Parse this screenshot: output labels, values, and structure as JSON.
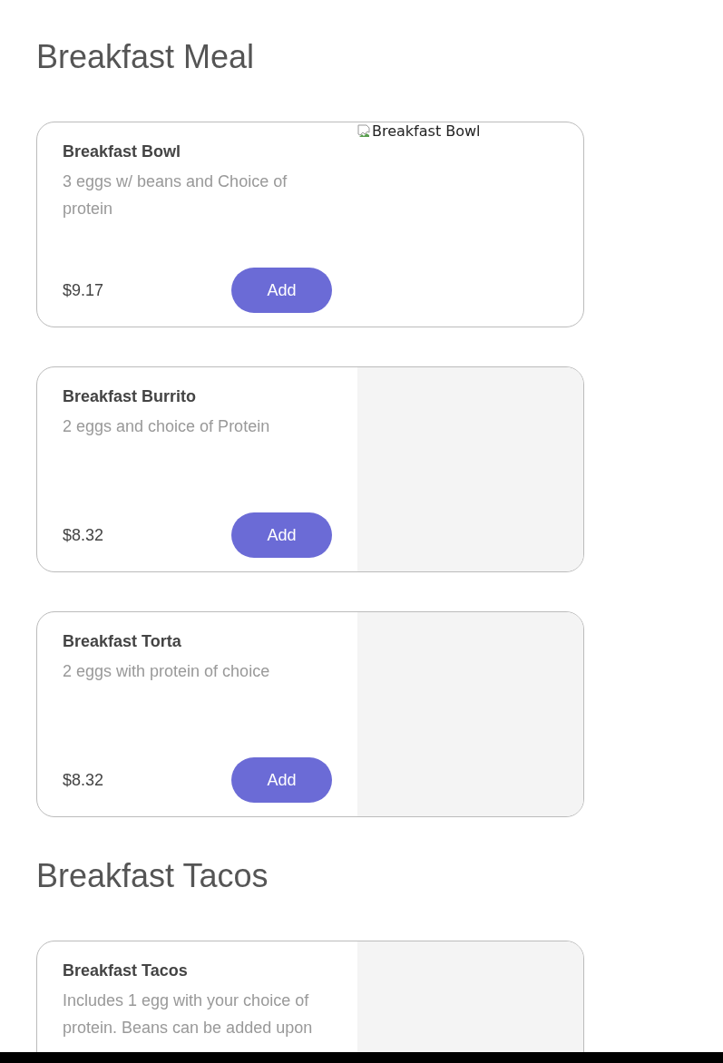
{
  "sections": [
    {
      "title": "Breakfast Meal",
      "items": [
        {
          "name": "Breakfast Bowl",
          "description": "3 eggs w/ beans and Choice of protein",
          "price": "$9.17",
          "button": "Add",
          "image": {
            "kind": "broken",
            "alt": "Breakfast Bowl"
          }
        },
        {
          "name": "Breakfast Burrito",
          "description": "2 eggs and choice of Protein",
          "price": "$8.32",
          "button": "Add",
          "image": {
            "kind": "placeholder"
          }
        },
        {
          "name": "Breakfast Torta",
          "description": "2 eggs with protein of choice",
          "price": "$8.32",
          "button": "Add",
          "image": {
            "kind": "placeholder"
          }
        }
      ]
    },
    {
      "title": "Breakfast Tacos",
      "items": [
        {
          "name": "Breakfast Tacos",
          "description": "Includes 1 egg with your choice of protein. Beans can be added upon",
          "image": {
            "kind": "placeholder"
          }
        }
      ]
    }
  ]
}
